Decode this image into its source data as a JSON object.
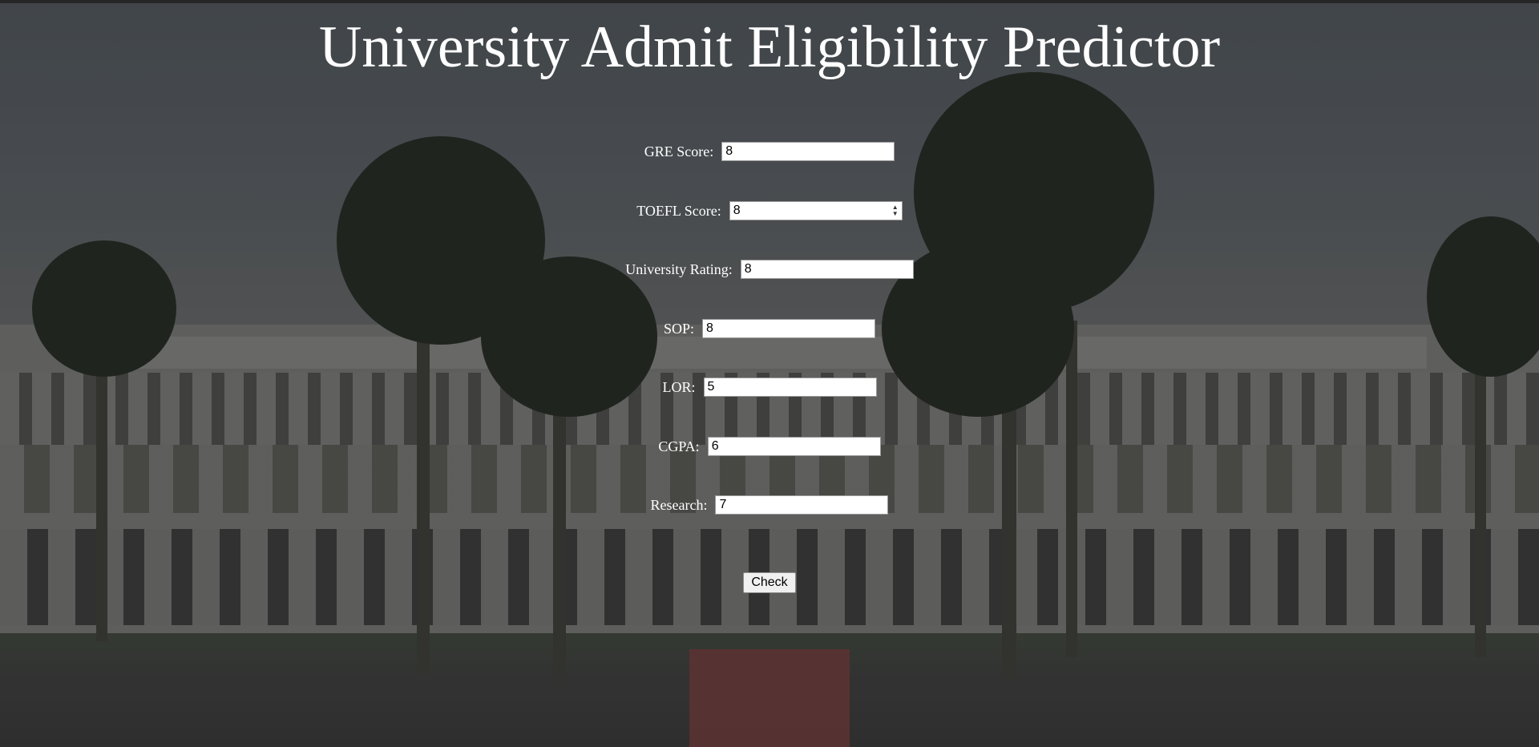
{
  "page": {
    "title": "University Admit Eligibility Predictor"
  },
  "form": {
    "fields": [
      {
        "label": "GRE Score:",
        "value": "8",
        "type": "text"
      },
      {
        "label": "TOEFL Score:",
        "value": "8",
        "type": "number"
      },
      {
        "label": "University Rating:",
        "value": "8",
        "type": "text"
      },
      {
        "label": "SOP:",
        "value": "8",
        "type": "text"
      },
      {
        "label": "LOR:",
        "value": "5",
        "type": "text"
      },
      {
        "label": "CGPA:",
        "value": "6",
        "type": "text"
      },
      {
        "label": "Research:",
        "value": "7",
        "type": "text"
      }
    ],
    "submit_label": "Check"
  },
  "icons": {
    "spinner": "number-spinner-icon"
  }
}
